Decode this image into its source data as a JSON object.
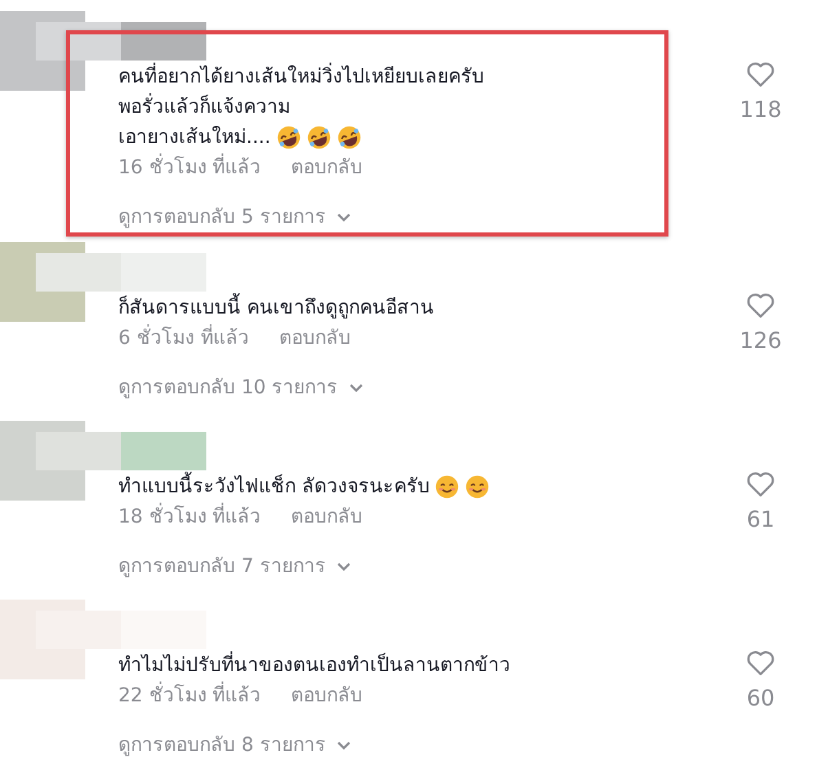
{
  "comments": [
    {
      "highlighted": true,
      "lines": [
        {
          "text": "คนที่อยากได้ยางเส้นใหม่วิ่งไปเหยียบเลยครับ"
        },
        {
          "text": "พอรั่วแล้วก็แจ้งความ"
        },
        {
          "text": "เอายางเส้นใหม่....",
          "icons": [
            {
              "kind": "laughing"
            },
            {
              "kind": "laughing"
            },
            {
              "kind": "laughing"
            }
          ]
        }
      ],
      "time": "16 ชั่วโมง ที่แล้ว",
      "reply": "ตอบกลับ",
      "likes": "118",
      "view_replies": "ดูการตอบกลับ 5 รายการ"
    },
    {
      "highlighted": false,
      "lines": [
        {
          "text": "ก็สันดารแบบนี้ คนเขาถึงดูถูกคนอีสาน"
        }
      ],
      "time": "6 ชั่วโมง ที่แล้ว",
      "reply": "ตอบกลับ",
      "likes": "126",
      "view_replies": "ดูการตอบกลับ 10 รายการ"
    },
    {
      "highlighted": false,
      "lines": [
        {
          "text": "ทำแบบนี้ระวังไฟแช็ก ลัดวงจรนะครับ",
          "icons": [
            {
              "kind": "smiling"
            },
            {
              "kind": "smiling"
            }
          ]
        }
      ],
      "time": "18 ชั่วโมง ที่แล้ว",
      "reply": "ตอบกลับ",
      "likes": "61",
      "view_replies": "ดูการตอบกลับ 7 รายการ"
    },
    {
      "highlighted": false,
      "lines": [
        {
          "text": "ทำไมไม่ปรับที่นาของตนเองทำเป็นลานตากข้าว"
        }
      ],
      "time": "22 ชั่วโมง ที่แล้ว",
      "reply": "ตอบกลับ",
      "likes": "60",
      "view_replies": "ดูการตอบกลับ 8 รายการ"
    }
  ]
}
